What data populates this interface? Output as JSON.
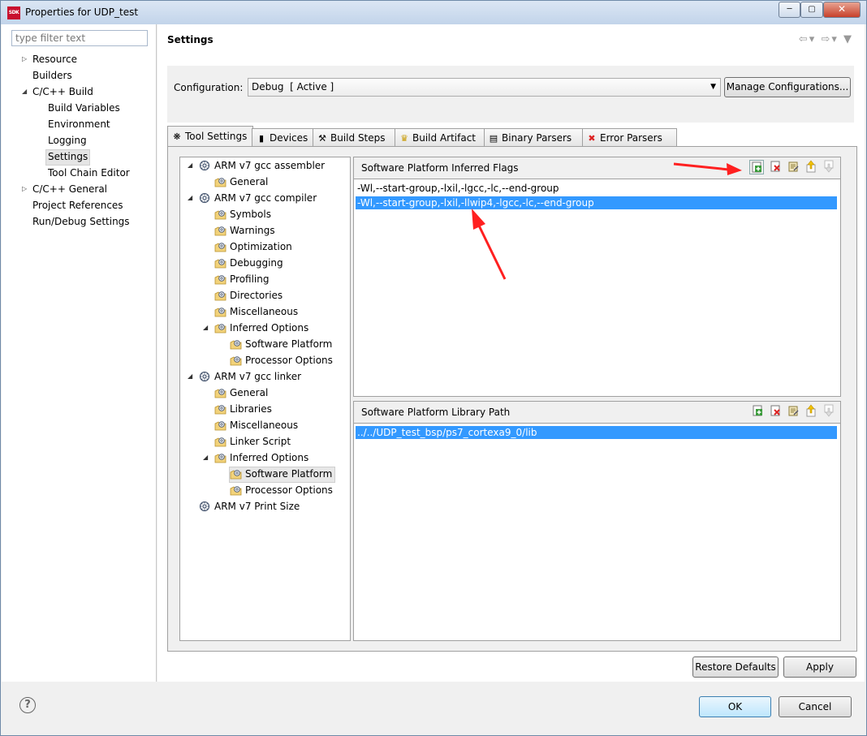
{
  "window": {
    "title": "Properties for UDP_test",
    "icon_label": "SDK",
    "controls": [
      "minimize",
      "maximize",
      "close"
    ]
  },
  "nav": {
    "filter_placeholder": "type filter text",
    "items": [
      {
        "label": "Resource",
        "expandable": true
      },
      {
        "label": "Builders"
      },
      {
        "label": "C/C++ Build",
        "expanded": true
      },
      {
        "label": "Build Variables"
      },
      {
        "label": "Environment"
      },
      {
        "label": "Logging"
      },
      {
        "label": "Settings",
        "selected": true
      },
      {
        "label": "Tool Chain Editor"
      },
      {
        "label": "C/C++ General",
        "expandable": true
      },
      {
        "label": "Project References"
      },
      {
        "label": "Run/Debug Settings"
      }
    ]
  },
  "page": {
    "title": "Settings",
    "configuration_label": "Configuration:",
    "configuration_value": "Debug  [ Active ]",
    "manage_button": "Manage Configurations..."
  },
  "tabs": [
    {
      "label": "Tool Settings",
      "icon": "tool-settings-icon",
      "active": true
    },
    {
      "label": "Devices",
      "icon": "devices-icon"
    },
    {
      "label": "Build Steps",
      "icon": "build-steps-icon"
    },
    {
      "label": "Build Artifact",
      "icon": "build-artifact-icon"
    },
    {
      "label": "Binary Parsers",
      "icon": "binary-parsers-icon"
    },
    {
      "label": "Error Parsers",
      "icon": "error-parsers-icon"
    }
  ],
  "tool_tree": [
    {
      "label": "ARM v7 gcc assembler",
      "icon": "tool-gear-icon"
    },
    {
      "label": "General",
      "icon": "option-category-icon"
    },
    {
      "label": "ARM v7 gcc compiler",
      "icon": "tool-gear-icon"
    },
    {
      "label": "Symbols",
      "icon": "option-category-icon"
    },
    {
      "label": "Warnings",
      "icon": "option-category-icon"
    },
    {
      "label": "Optimization",
      "icon": "option-category-icon"
    },
    {
      "label": "Debugging",
      "icon": "option-category-icon"
    },
    {
      "label": "Profiling",
      "icon": "option-category-icon"
    },
    {
      "label": "Directories",
      "icon": "option-category-icon"
    },
    {
      "label": "Miscellaneous",
      "icon": "option-category-icon"
    },
    {
      "label": "Inferred Options",
      "icon": "option-category-icon"
    },
    {
      "label": "Software Platform",
      "icon": "option-category-icon"
    },
    {
      "label": "Processor Options",
      "icon": "option-category-icon"
    },
    {
      "label": "ARM v7 gcc linker",
      "icon": "tool-gear-icon"
    },
    {
      "label": "General",
      "icon": "option-category-icon"
    },
    {
      "label": "Libraries",
      "icon": "option-category-icon"
    },
    {
      "label": "Miscellaneous",
      "icon": "option-category-icon"
    },
    {
      "label": "Linker Script",
      "icon": "option-category-icon"
    },
    {
      "label": "Inferred Options",
      "icon": "option-category-icon"
    },
    {
      "label": "Software Platform",
      "icon": "option-category-icon",
      "selected": true
    },
    {
      "label": "Processor Options",
      "icon": "option-category-icon"
    },
    {
      "label": "ARM v7 Print Size",
      "icon": "tool-gear-icon"
    }
  ],
  "flags_panel": {
    "title": "Software Platform Inferred Flags",
    "rows": [
      "-Wl,--start-group,-lxil,-lgcc,-lc,--end-group",
      "-Wl,--start-group,-lxil,-llwip4,-lgcc,-lc,--end-group"
    ],
    "selected_row": 1,
    "tools": [
      "add-icon",
      "delete-icon",
      "edit-icon",
      "move-up-icon",
      "move-down-icon"
    ]
  },
  "libpath_panel": {
    "title": "Software Platform Library Path",
    "rows": [
      "../../UDP_test_bsp/ps7_cortexa9_0/lib"
    ],
    "selected_row": 0,
    "tools": [
      "add-icon",
      "delete-icon",
      "edit-icon",
      "move-up-icon",
      "move-down-icon"
    ]
  },
  "buttons": {
    "restore_defaults": "Restore Defaults",
    "apply": "Apply",
    "ok": "OK",
    "cancel": "Cancel"
  },
  "colors": {
    "selection": "#3399ff",
    "annotation_arrow": "#ff2020"
  }
}
